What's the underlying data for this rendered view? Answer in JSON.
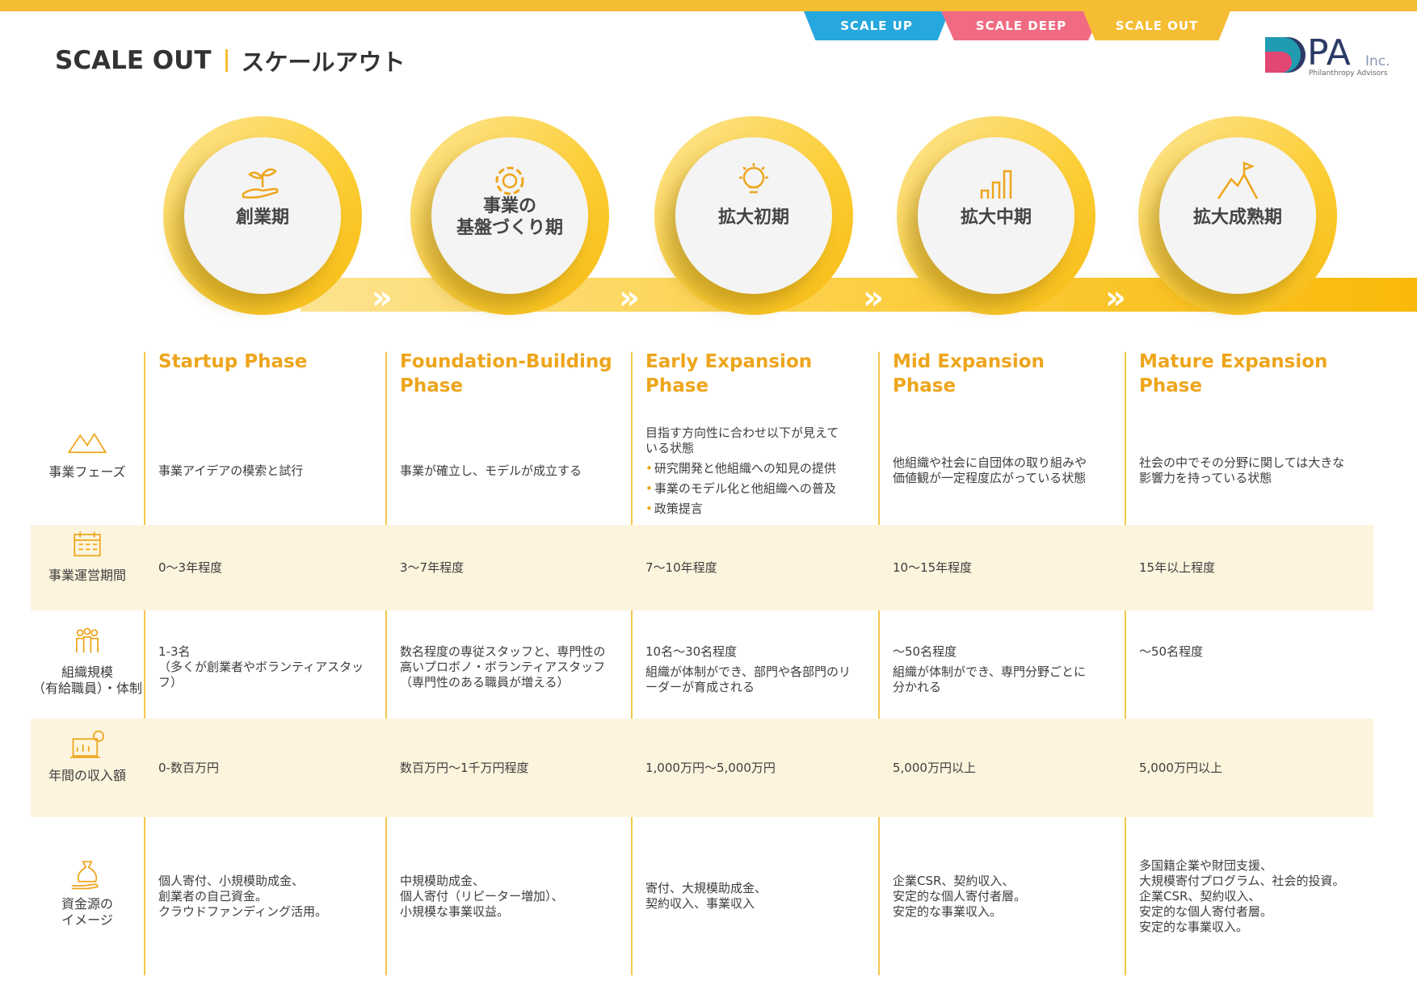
{
  "header": {
    "title_en": "SCALE OUT",
    "title_jp": "スケールアウト",
    "tabs": [
      "SCALE UP",
      "SCALE DEEP",
      "SCALE OUT"
    ],
    "logo_text": "PA",
    "logo_inc": "Inc.",
    "logo_sub": "Philanthropy Advisors"
  },
  "colors": {
    "accent": "#f5bd33",
    "heading": "#eea51c",
    "scale_up": "#26a8de",
    "scale_deep": "#f06b82",
    "row_tint": "#fdf4dd"
  },
  "phases": [
    {
      "jp": [
        "創業期"
      ],
      "en": [
        "Startup Phase"
      ],
      "icon": "sprout-in-hand-icon"
    },
    {
      "jp": [
        "事業の",
        "基盤づくり期"
      ],
      "en": [
        "Foundation-Building",
        "Phase"
      ],
      "icon": "gear-icon"
    },
    {
      "jp": [
        "拡大初期"
      ],
      "en": [
        "Early Expansion",
        "Phase"
      ],
      "icon": "lightbulb-icon"
    },
    {
      "jp": [
        "拡大中期"
      ],
      "en": [
        "Mid Expansion",
        "Phase"
      ],
      "icon": "bar-growth-icon"
    },
    {
      "jp": [
        "拡大成熟期"
      ],
      "en": [
        "Mature Expansion",
        "Phase"
      ],
      "icon": "mountain-flag-icon"
    }
  ],
  "rows": [
    {
      "label": [
        "事業フェーズ"
      ],
      "icon": "mountains-icon",
      "cells": [
        {
          "lines": [
            "事業アイデアの模索と試行"
          ]
        },
        {
          "lines": [
            "事業が確立し、モデルが成立する"
          ]
        },
        {
          "lines": [
            "目指す方向性に合わせ以下が見えて",
            "いる状態"
          ],
          "bullets": [
            "研究開発と他組織への知見の提供",
            "事業のモデル化と他組織への普及",
            "政策提言"
          ]
        },
        {
          "lines": [
            "他組織や社会に自団体の取り組みや",
            "価値観が一定程度広がっている状態"
          ]
        },
        {
          "lines": [
            "社会の中でその分野に関しては大きな",
            "影響力を持っている状態"
          ]
        }
      ]
    },
    {
      "label": [
        "事業運営期間"
      ],
      "icon": "calendar-icon",
      "cells": [
        {
          "lines": [
            "0〜3年程度"
          ]
        },
        {
          "lines": [
            "3〜7年程度"
          ]
        },
        {
          "lines": [
            "7〜10年程度"
          ]
        },
        {
          "lines": [
            "10〜15年程度"
          ]
        },
        {
          "lines": [
            "15年以上程度"
          ]
        }
      ]
    },
    {
      "label": [
        "組織規模",
        "（有給職員）・体制"
      ],
      "icon": "team-icon",
      "cells": [
        {
          "lines": [
            "1-3名",
            "（多くが創業者やボランティアスタッフ）"
          ]
        },
        {
          "lines": [
            "数名程度の専従スタッフと、専門性の",
            "高いプロボノ・ボランティアスタッフ",
            "（専門性のある職員が増える）"
          ]
        },
        {
          "lines": [
            "10名〜30名程度"
          ],
          "extra": [
            "組織が体制ができ、部門や各部門のリ",
            "ーダーが育成される"
          ]
        },
        {
          "lines": [
            "〜50名程度"
          ],
          "extra": [
            "組織が体制ができ、専門分野ごとに",
            "分かれる"
          ]
        },
        {
          "lines": [
            "〜50名程度"
          ]
        }
      ]
    },
    {
      "label": [
        "年間の収入額"
      ],
      "icon": "revenue-chart-icon",
      "cells": [
        {
          "lines": [
            "0-数百万円"
          ]
        },
        {
          "lines": [
            "数百万円〜1千万円程度"
          ]
        },
        {
          "lines": [
            "1,000万円〜5,000万円"
          ]
        },
        {
          "lines": [
            "5,000万円以上"
          ]
        },
        {
          "lines": [
            "5,000万円以上"
          ]
        }
      ]
    },
    {
      "label": [
        "資金源の",
        "イメージ"
      ],
      "icon": "money-bag-hand-icon",
      "cells": [
        {
          "lines": [
            "個人寄付、小規模助成金、",
            "創業者の自己資金。",
            "クラウドファンディング活用。"
          ]
        },
        {
          "lines": [
            "中規模助成金、",
            "個人寄付（リピーター増加）、",
            "小規模な事業収益。"
          ]
        },
        {
          "lines": [
            "寄付、大規模助成金、",
            "契約収入、事業収入"
          ]
        },
        {
          "lines": [
            "企業CSR、契約収入、",
            "安定的な個人寄付者層。",
            "安定的な事業収入。"
          ]
        },
        {
          "lines": [
            "多国籍企業や財団支援、",
            "大規模寄付プログラム、社会的投資。",
            "企業CSR、契約収入、",
            "安定的な個人寄付者層。",
            "安定的な事業収入。"
          ]
        }
      ]
    }
  ]
}
